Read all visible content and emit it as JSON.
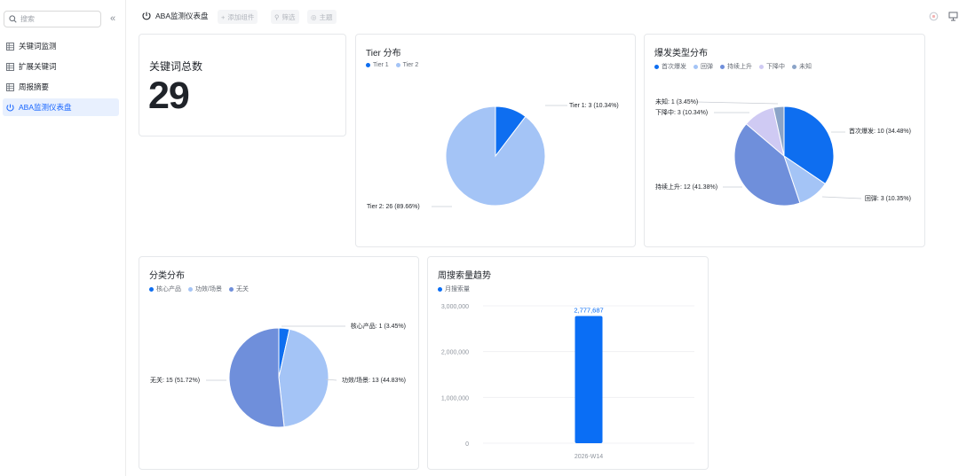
{
  "sidebar": {
    "search_placeholder": "搜索",
    "items": [
      {
        "label": "关键词监测",
        "active": false
      },
      {
        "label": "扩展关键词",
        "active": false
      },
      {
        "label": "周报摘要",
        "active": false
      },
      {
        "label": "ABA监测仪表盘",
        "active": true
      }
    ]
  },
  "topbar": {
    "title": "ABA监测仪表盘",
    "add_widget": "添加组件",
    "filter": "筛选",
    "theme": "主题"
  },
  "colors": {
    "accent": "#1664ff",
    "bar": "#0a6ef5"
  },
  "kpi": {
    "label": "关键词总数",
    "value": "29"
  },
  "chart_data": [
    {
      "type": "pie",
      "title": "Tier 分布",
      "categories": [
        "Tier 1",
        "Tier 2"
      ],
      "values": [
        3,
        26
      ],
      "labels": [
        "Tier 1: 3 (10.34%)",
        "Tier 2: 26 (89.66%)"
      ],
      "colors": [
        "#0e6ef0",
        "#a4c4f6"
      ],
      "legend": "top-left"
    },
    {
      "type": "pie",
      "title": "爆发类型分布",
      "categories": [
        "首次爆发",
        "回弹",
        "持续上升",
        "下降中",
        "未知"
      ],
      "values": [
        10,
        3,
        12,
        3,
        1
      ],
      "labels": [
        "首次爆发: 10 (34.48%)",
        "回弹: 3 (10.35%)",
        "持续上升: 12 (41.38%)",
        "下降中: 3 (10.34%)",
        "未知: 1 (3.45%)"
      ],
      "colors": [
        "#0e6ef0",
        "#a4c4f6",
        "#6f8fdb",
        "#cfcaf3",
        "#8ba4c8"
      ],
      "legend": "top-left"
    },
    {
      "type": "pie",
      "title": "分类分布",
      "categories": [
        "核心产品",
        "功效/场景",
        "无关"
      ],
      "values": [
        1,
        13,
        15
      ],
      "labels": [
        "核心产品: 1 (3.45%)",
        "功效/场景: 13 (44.83%)",
        "无关: 15 (51.72%)"
      ],
      "colors": [
        "#0e6ef0",
        "#a4c4f6",
        "#6f8fdb"
      ],
      "legend": "top-left"
    },
    {
      "type": "bar",
      "title": "周搜索量趋势",
      "categories": [
        "2026-W14"
      ],
      "series": [
        {
          "name": "月搜索量",
          "values": [
            2777687
          ]
        }
      ],
      "value_labels": [
        "2,777,687"
      ],
      "ylim": [
        0,
        3000000
      ],
      "yticks": [
        "3,000,000",
        "2,000,000",
        "1,000,000",
        "0"
      ],
      "grid": true,
      "legend": "top-left"
    }
  ]
}
